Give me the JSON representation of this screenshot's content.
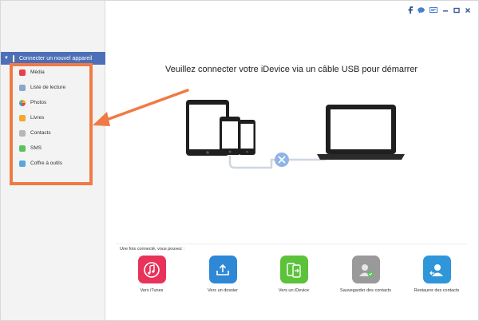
{
  "titlebar": {
    "icons": [
      "facebook-icon",
      "chat-icon",
      "screen-icon",
      "minimize-icon",
      "maximize-icon",
      "close-icon"
    ]
  },
  "sidebar": {
    "device_header": "Connecter un nouvel appareil",
    "items": [
      {
        "label": "Média",
        "icon": "media-icon",
        "color": "#e8414a"
      },
      {
        "label": "Liste de lecture",
        "icon": "playlist-icon",
        "color": "#8ba6cc"
      },
      {
        "label": "Photos",
        "icon": "photos-icon",
        "color": "#f4a623"
      },
      {
        "label": "Livres",
        "icon": "books-icon",
        "color": "#f2a92c"
      },
      {
        "label": "Contacts",
        "icon": "contacts-icon",
        "color": "#b7b7b7"
      },
      {
        "label": "SMS",
        "icon": "sms-icon",
        "color": "#5cc25c"
      },
      {
        "label": "Coffre à outils",
        "icon": "toolbox-icon",
        "color": "#5aa7df"
      }
    ]
  },
  "main": {
    "headline": "Veuillez connecter votre iDevice via un câble USB pour démarrer",
    "once_connected": "Une fois connecté, vous pouvez :",
    "actions": [
      {
        "label": "Vers iTunes",
        "icon": "itunes-icon",
        "color": "#e8325a"
      },
      {
        "label": "Vers un dossier",
        "icon": "folder-export-icon",
        "color": "#2e88d6"
      },
      {
        "label": "Vers un iDevice",
        "icon": "device-transfer-icon",
        "color": "#5cc23a"
      },
      {
        "label": "Sauvegarder des contacts",
        "icon": "backup-contacts-icon",
        "color": "#9a9a9a"
      },
      {
        "label": "Restaurer des contacts",
        "icon": "restore-contacts-icon",
        "color": "#2e96d9"
      }
    ]
  },
  "colors": {
    "accent": "#4d6fb8",
    "highlight": "#f07a45"
  }
}
